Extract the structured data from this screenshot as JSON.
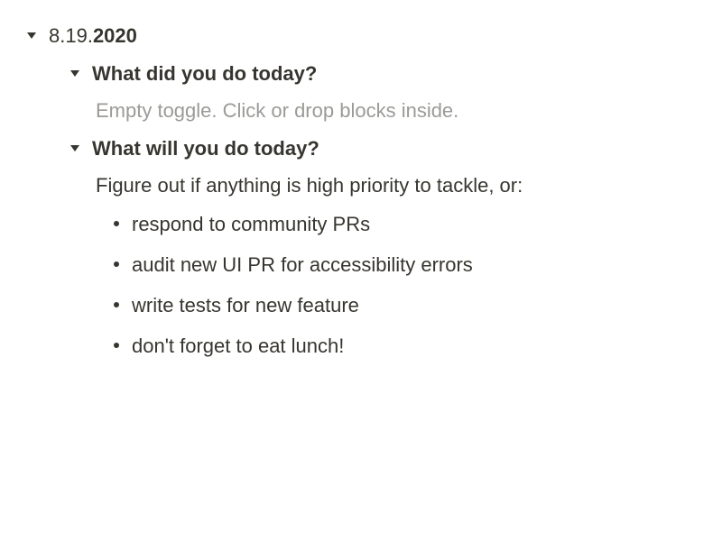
{
  "date": {
    "prefix": "8.19.",
    "year": "2020"
  },
  "sections": {
    "did": {
      "heading": "What did you do today?",
      "placeholder": "Empty toggle. Click or drop blocks inside."
    },
    "will": {
      "heading": "What will you do today?",
      "intro": "Figure out if anything is high priority to tackle, or:",
      "bullets": [
        "respond to community PRs",
        "audit new UI PR for accessibility errors",
        "write tests for new feature",
        "don't forget to eat lunch!"
      ]
    }
  }
}
